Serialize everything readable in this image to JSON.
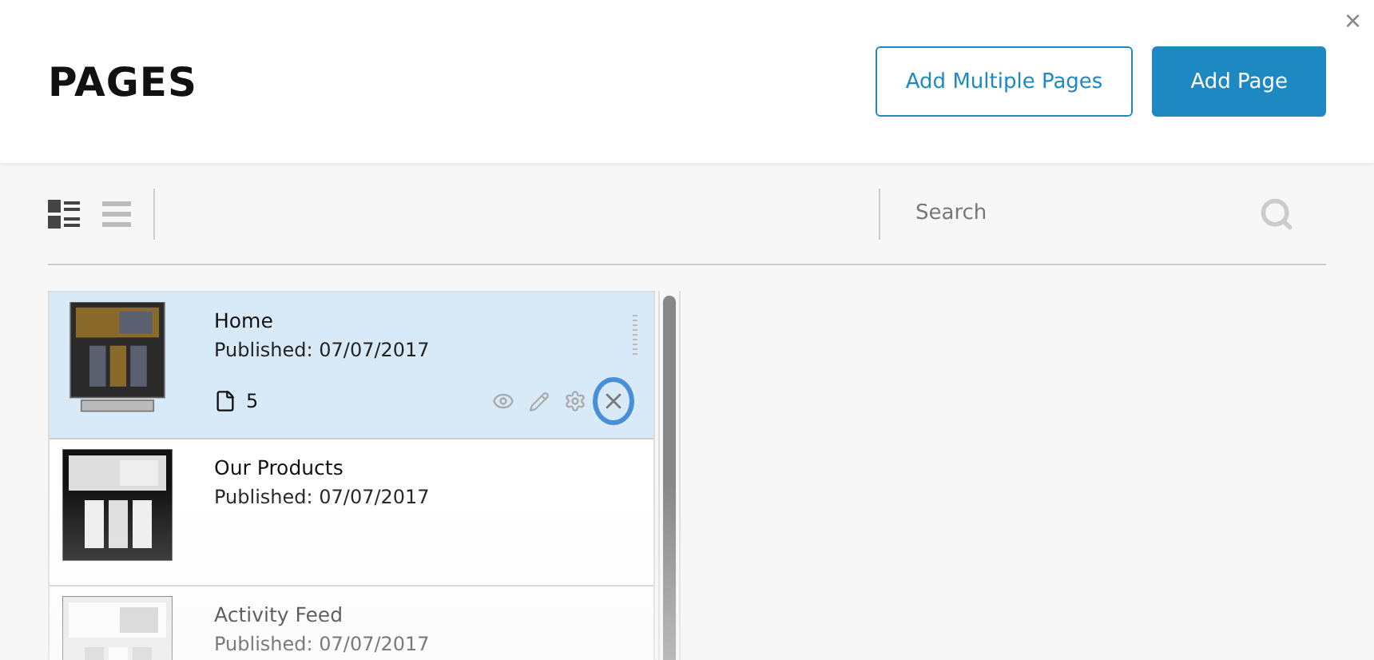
{
  "header": {
    "title": "PAGES",
    "close": "×",
    "buttons": [
      {
        "label": "Add Multiple Pages",
        "kind": "outline"
      },
      {
        "label": "Add Page",
        "kind": "primary"
      }
    ]
  },
  "view_modes": [
    {
      "kind": "thumbs",
      "selected": true
    },
    {
      "kind": "list",
      "selected": false
    }
  ],
  "search": {
    "placeholder": "Search"
  },
  "pages": [
    {
      "name": "Home",
      "published": "Published: 07/07/2017",
      "selected": true,
      "subpages": "5"
    },
    {
      "name": "Our Products",
      "published": "Published: 07/07/2017",
      "selected": false
    },
    {
      "name": "Activity Feed",
      "published": "Published: 07/07/2017",
      "selected": false
    }
  ]
}
